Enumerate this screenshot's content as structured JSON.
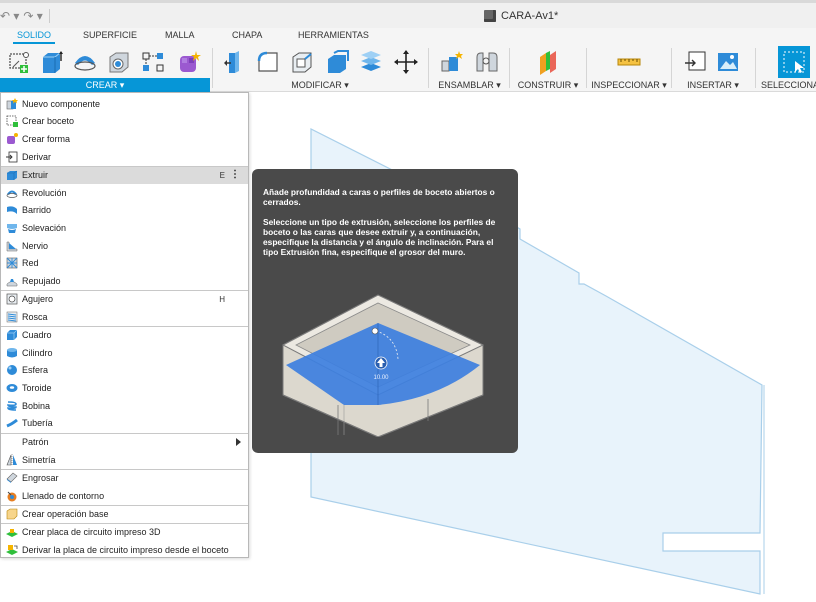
{
  "window": {
    "title": "CARA-Av1*"
  },
  "tabs": [
    {
      "label": "SOLIDO",
      "active": true
    },
    {
      "label": "SUPERFICIE",
      "active": false
    },
    {
      "label": "MALLA",
      "active": false
    },
    {
      "label": "CHAPA",
      "active": false
    },
    {
      "label": "HERRAMIENTAS",
      "active": false
    }
  ],
  "groups": {
    "crear": "CREAR ▾",
    "modificar": "MODIFICAR ▾",
    "ensamblar": "ENSAMBLAR ▾",
    "construir": "CONSTRUIR ▾",
    "inspeccionar": "INSPECCIONAR ▾",
    "insertar": "INSERTAR ▾",
    "seleccionar": "SELECCIONAR"
  },
  "menu": {
    "items": [
      {
        "label": "Nuevo componente",
        "icon": "new-component-icon"
      },
      {
        "label": "Crear boceto",
        "icon": "sketch-icon"
      },
      {
        "label": "Crear forma",
        "icon": "form-icon"
      },
      {
        "label": "Derivar",
        "icon": "derive-icon"
      },
      {
        "label": "Extruir",
        "icon": "extrude-icon",
        "shortcut": "E"
      },
      {
        "label": "Revolución",
        "icon": "revolve-icon"
      },
      {
        "label": "Barrido",
        "icon": "sweep-icon"
      },
      {
        "label": "Solevación",
        "icon": "loft-icon"
      },
      {
        "label": "Nervio",
        "icon": "rib-icon"
      },
      {
        "label": "Red",
        "icon": "web-icon"
      },
      {
        "label": "Repujado",
        "icon": "emboss-icon"
      },
      {
        "label": "Agujero",
        "icon": "hole-icon",
        "shortcut": "H"
      },
      {
        "label": "Rosca",
        "icon": "thread-icon"
      },
      {
        "label": "Cuadro",
        "icon": "box-icon"
      },
      {
        "label": "Cilindro",
        "icon": "cylinder-icon"
      },
      {
        "label": "Esfera",
        "icon": "sphere-icon"
      },
      {
        "label": "Toroide",
        "icon": "torus-icon"
      },
      {
        "label": "Bobina",
        "icon": "coil-icon"
      },
      {
        "label": "Tubería",
        "icon": "pipe-icon"
      },
      {
        "label": "Patrón",
        "icon": ""
      },
      {
        "label": "Simetría",
        "icon": "mirror-icon"
      },
      {
        "label": "Engrosar",
        "icon": "thicken-icon"
      },
      {
        "label": "Llenado de contorno",
        "icon": "boundary-fill-icon"
      },
      {
        "label": "Crear operación base",
        "icon": "base-feature-icon"
      },
      {
        "label": "Crear placa de circuito impreso 3D",
        "icon": "pcb-icon"
      },
      {
        "label": "Derivar la placa de circuito impreso desde el boceto",
        "icon": "pcb-derive-icon"
      }
    ]
  },
  "tooltip": {
    "p1": "Añade profundidad a caras o perfiles de boceto abiertos o cerrados.",
    "p2": "Seleccione un tipo de extrusión, seleccione los perfiles de boceto o las caras que desee extruir y, a continuación, especifique la distancia y el ángulo de inclinación. Para el tipo Extrusión fina, especifique el grosor del muro.",
    "illus_value": "10.00"
  },
  "colors": {
    "accent": "#0696d7",
    "tooltip_bg": "#4a4a4a",
    "highlight": "#dbdbdb"
  }
}
